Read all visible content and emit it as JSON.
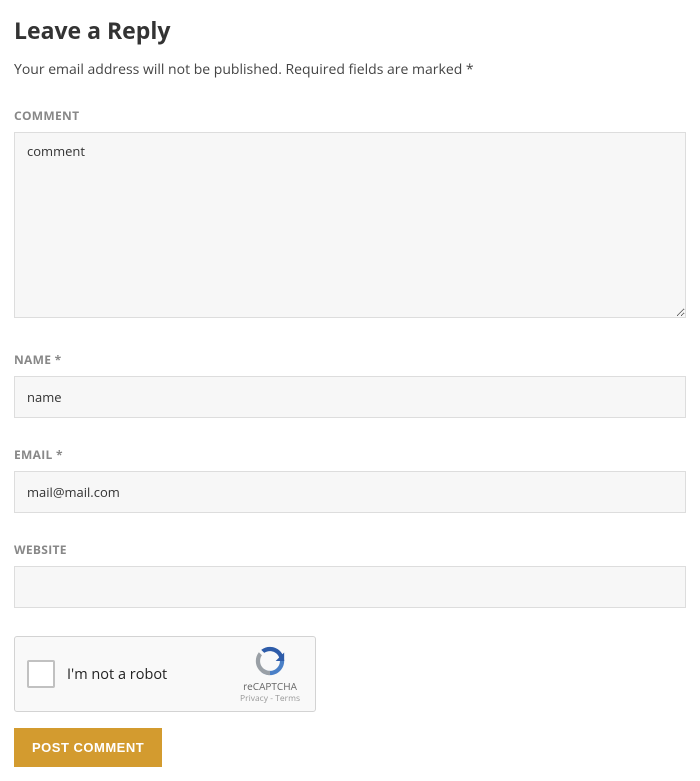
{
  "heading": "Leave a Reply",
  "subtext": "Your email address will not be published. Required fields are marked *",
  "form": {
    "comment": {
      "label": "COMMENT",
      "value": "comment"
    },
    "name": {
      "label": "NAME *",
      "value": "name"
    },
    "email": {
      "label": "EMAIL *",
      "value": "mail@mail.com"
    },
    "website": {
      "label": "WEBSITE",
      "value": ""
    }
  },
  "recaptcha": {
    "label": "I'm not a robot",
    "brand": "reCAPTCHA",
    "terms": "Privacy - Terms"
  },
  "submit_label": "POST COMMENT"
}
